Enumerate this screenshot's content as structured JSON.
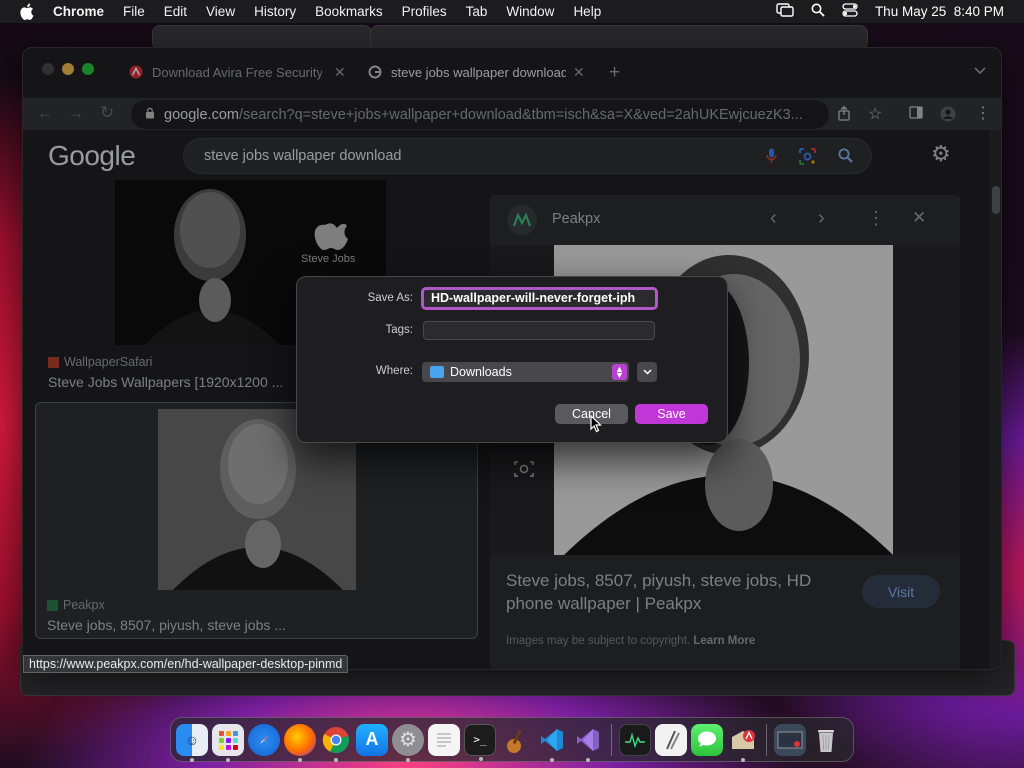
{
  "menubar": {
    "app": "Chrome",
    "items": [
      "File",
      "Edit",
      "View",
      "History",
      "Bookmarks",
      "Profiles",
      "Tab",
      "Window",
      "Help"
    ],
    "datetime": "Thu May 25  8:40 PM"
  },
  "browser": {
    "tabs": [
      {
        "title": "Download Avira Free Security f",
        "favicon": "avira-icon",
        "color": "#e0323c"
      },
      {
        "title": "steve jobs wallpaper download",
        "favicon": "google-icon",
        "color": "#c4c7c5"
      }
    ],
    "url_host": "google.com",
    "url_path": "/search?q=steve+jobs+wallpaper+download&tbm=isch&sa=X&ved=2ahUKEwjcuezK3..."
  },
  "google": {
    "logo": "Google",
    "query": "steve jobs wallpaper download",
    "results": [
      {
        "source": "WallpaperSafari",
        "title": "Steve Jobs Wallpapers [1920x1200 ..."
      },
      {
        "source": "Peakpx",
        "title": "Steve jobs, 8507, piyush, steve jobs ..."
      }
    ],
    "apple_caption": "Steve Jobs"
  },
  "preview": {
    "site": "Peakpx",
    "title": "Steve jobs, 8507, piyush, steve jobs, HD phone wallpaper | Peakpx",
    "visit": "Visit",
    "copyright": "Images may be subject to copyright.",
    "learn_more": "Learn More"
  },
  "status_url": "https://www.peakpx.com/en/hd-wallpaper-desktop-pinmd",
  "dialog": {
    "save_as_label": "Save As:",
    "save_as_value": "HD-wallpaper-will-never-forget-iph",
    "tags_label": "Tags:",
    "where_label": "Where:",
    "where_value": "Downloads",
    "cancel": "Cancel",
    "save": "Save"
  },
  "dock": [
    "finder",
    "launchpad",
    "safari",
    "firefox",
    "chrome",
    "app-store",
    "system-settings",
    "textedit",
    "terminal",
    "guitar",
    "vscode",
    "visual-studio",
    "activity-monitor",
    "script-editor",
    "messages",
    "avira",
    "screenshot",
    "trash"
  ]
}
